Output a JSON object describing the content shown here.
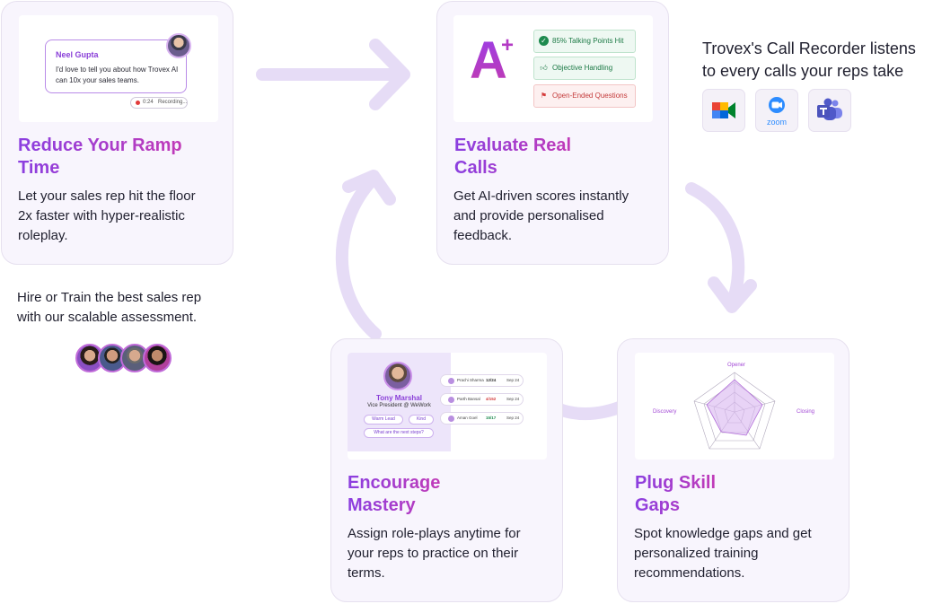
{
  "cards": {
    "ramp": {
      "title_line1": "Reduce Your Ramp",
      "title_line2": "Time",
      "desc_line1": "Let your sales rep hit the floor",
      "desc_line2": "2x faster with hyper-realistic",
      "desc_line3": "roleplay.",
      "preview": {
        "speaker": "Neel Gupta",
        "message": "I'd love to tell you about how Trovex AI can 10x your sales teams.",
        "rec_time": "0:24",
        "rec_label": "Recording..."
      }
    },
    "evaluate": {
      "title_line1": "Evaluate Real",
      "title_line2": "Calls",
      "desc_line1": "Get AI-driven scores instantly",
      "desc_line2": "and provide personalised",
      "desc_line3": "feedback.",
      "preview": {
        "grade": "A",
        "grade_mod": "+",
        "tags": [
          "85% Talking Points Hit",
          "Objective Handling",
          "Open-Ended Questions"
        ]
      }
    },
    "mastery": {
      "title_line1": "Encourage",
      "title_line2": "Mastery",
      "desc_line1": "Assign role-plays anytime for",
      "desc_line2": "your reps to practice on their",
      "desc_line3": "terms.",
      "preview": {
        "name": "Tony Marshal",
        "role": "Vice President @ WeWork",
        "chips": [
          "Warm Lead",
          "Kind"
        ],
        "next_steps": "What are the next steps?",
        "calls": [
          {
            "name": "Prachi Sharma",
            "score": "12/24",
            "date": "Sep 24",
            "color": "#333333"
          },
          {
            "name": "Parth Bansal",
            "score": "4/152",
            "date": "Sep 24",
            "color": "#d43c3c"
          },
          {
            "name": "Aman Goel",
            "score": "15/17",
            "date": "Sep 24",
            "color": "#1d8a4e"
          }
        ]
      }
    },
    "skills": {
      "title_line1": "Plug Skill",
      "title_line2": "Gaps",
      "desc_line1": "Spot knowledge gaps and get",
      "desc_line2": "personalized training",
      "desc_line3": "recommendations.",
      "preview": {
        "axes": [
          "Opener",
          "Closing",
          "Discovery"
        ]
      }
    }
  },
  "recorder": {
    "line1": "Trovex's Call Recorder listens",
    "line2": "to every calls your reps take",
    "apps": [
      {
        "icon": "google-meet-icon"
      },
      {
        "icon": "zoom-icon",
        "label": "zoom"
      },
      {
        "icon": "microsoft-teams-icon"
      }
    ]
  },
  "hire": {
    "line1": "Hire or Train the best sales rep",
    "line2": "with our scalable assessment."
  },
  "colors": {
    "brand_purple": "#8b3fe0",
    "brand_magenta": "#c13ab8",
    "card_bg": "#f8f5fd",
    "arrow": "#e6dcf6"
  }
}
